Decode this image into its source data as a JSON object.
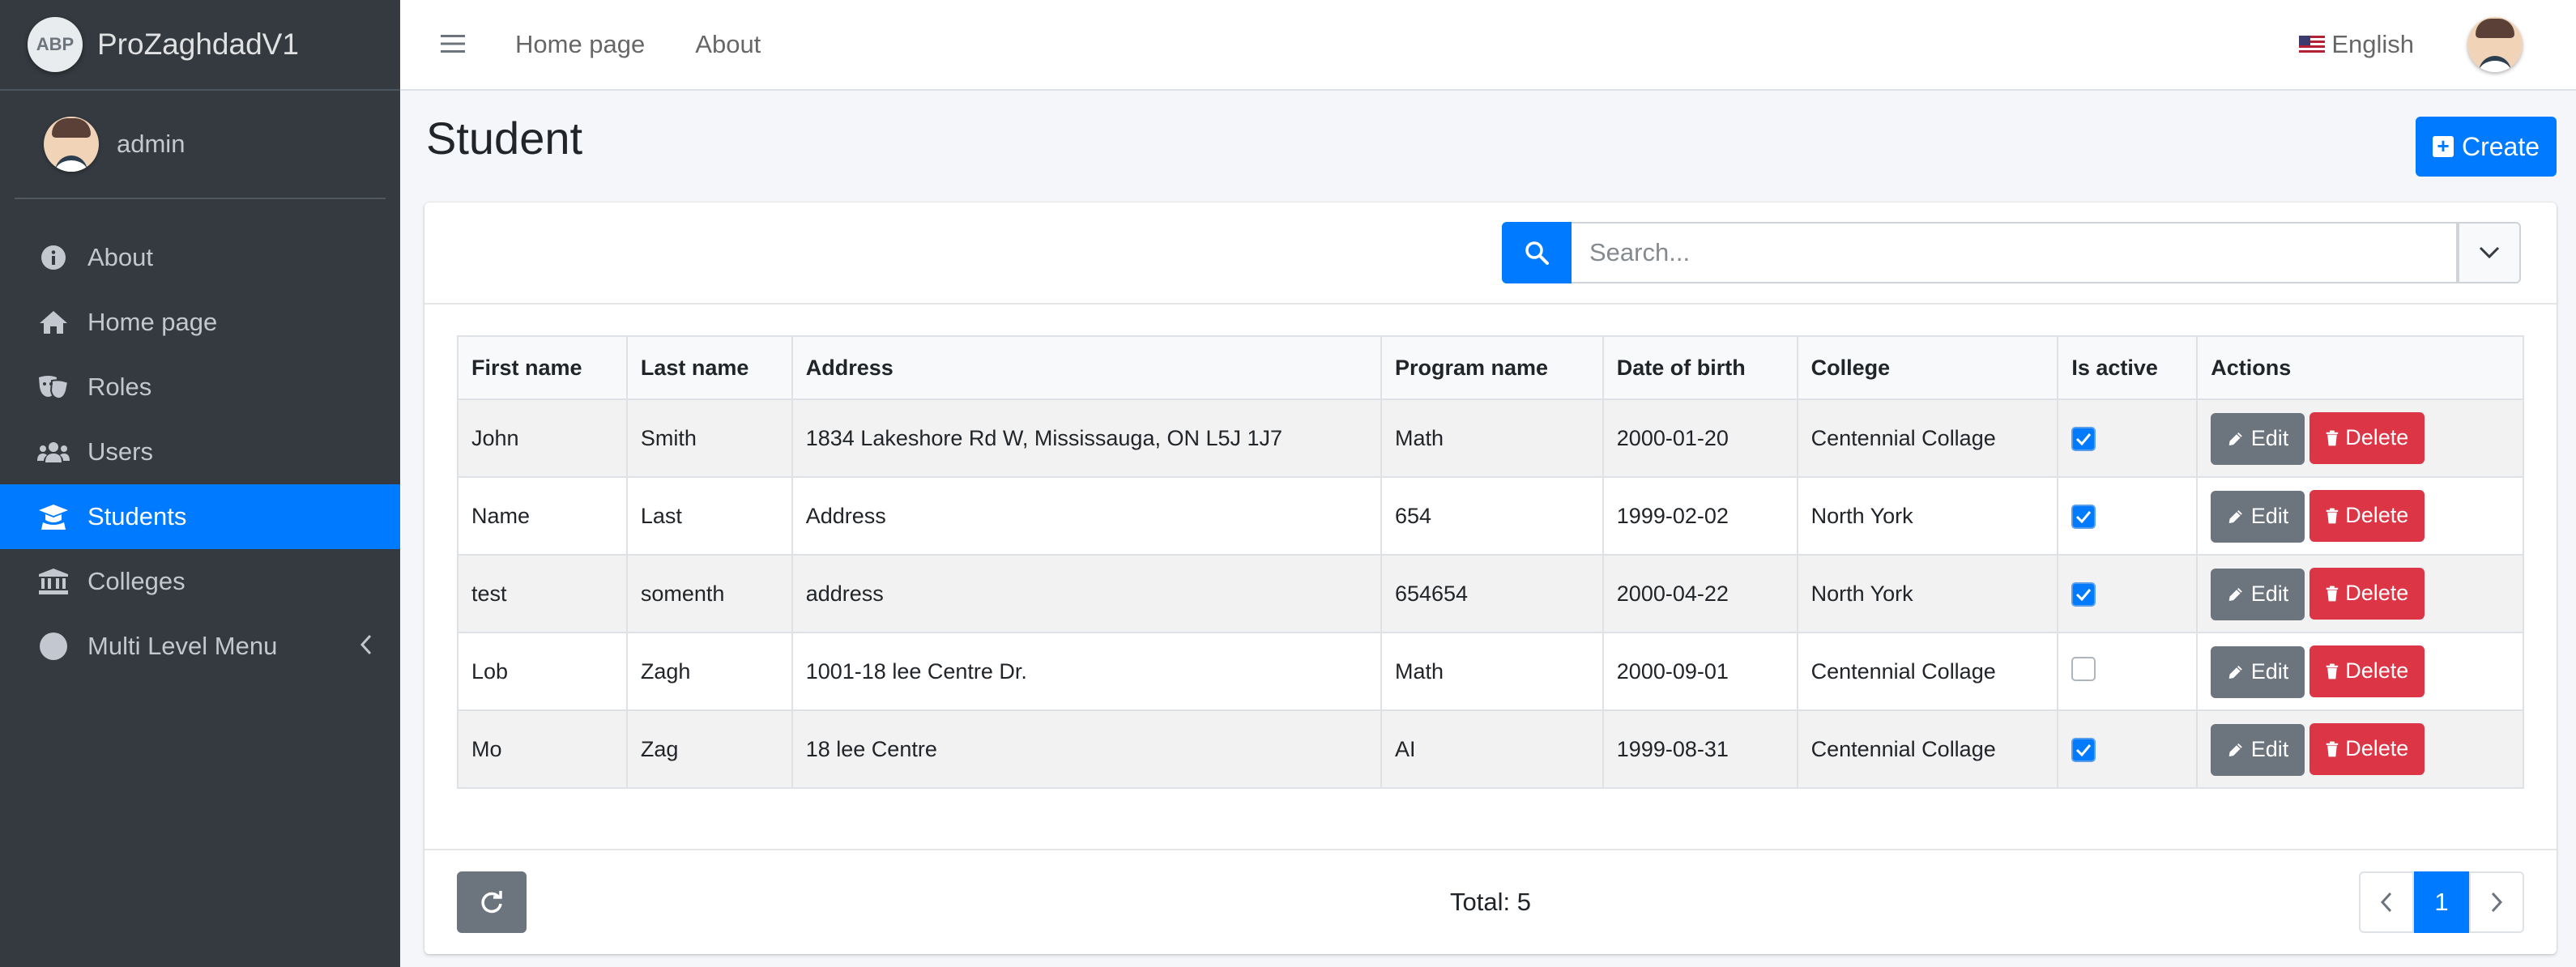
{
  "brand": {
    "logo_text": "ABP",
    "name": "ProZaghdadV1"
  },
  "user": {
    "name": "admin"
  },
  "sidebar": {
    "items": [
      {
        "label": "About",
        "icon": "info-circle-icon"
      },
      {
        "label": "Home page",
        "icon": "home-icon"
      },
      {
        "label": "Roles",
        "icon": "theater-masks-icon"
      },
      {
        "label": "Users",
        "icon": "users-icon"
      },
      {
        "label": "Students",
        "icon": "graduation-cap-icon",
        "active": true
      },
      {
        "label": "Colleges",
        "icon": "university-icon"
      },
      {
        "label": "Multi Level Menu",
        "icon": "circle-icon"
      }
    ]
  },
  "navbar": {
    "links": [
      "Home page",
      "About"
    ],
    "language": "English"
  },
  "page": {
    "title": "Student",
    "create_label": "Create"
  },
  "search": {
    "placeholder": "Search..."
  },
  "table": {
    "headers": [
      "First name",
      "Last name",
      "Address",
      "Program name",
      "Date of birth",
      "College",
      "Is active",
      "Actions"
    ],
    "rows": [
      {
        "first": "John",
        "last": "Smith",
        "address": "1834 Lakeshore Rd W, Mississauga, ON L5J 1J7",
        "program": "Math",
        "dob": "2000-01-20",
        "college": "Centennial Collage",
        "active": true
      },
      {
        "first": "Name",
        "last": "Last",
        "address": "Address",
        "program": "654",
        "dob": "1999-02-02",
        "college": "North York",
        "active": true
      },
      {
        "first": "test",
        "last": "somenth",
        "address": "address",
        "program": "654654",
        "dob": "2000-04-22",
        "college": "North York",
        "active": true
      },
      {
        "first": "Lob",
        "last": "Zagh",
        "address": "1001-18 lee Centre Dr.",
        "program": "Math",
        "dob": "2000-09-01",
        "college": "Centennial Collage",
        "active": false
      },
      {
        "first": "Mo",
        "last": "Zag",
        "address": "18 lee Centre",
        "program": "AI",
        "dob": "1999-08-31",
        "college": "Centennial Collage",
        "active": true
      }
    ],
    "edit_label": "Edit",
    "delete_label": "Delete"
  },
  "footer": {
    "total_text": "Total: 5",
    "current_page": "1"
  },
  "colors": {
    "primary": "#007bff",
    "danger": "#dc3545",
    "secondary": "#6c757d",
    "sidebar": "#343a40"
  }
}
